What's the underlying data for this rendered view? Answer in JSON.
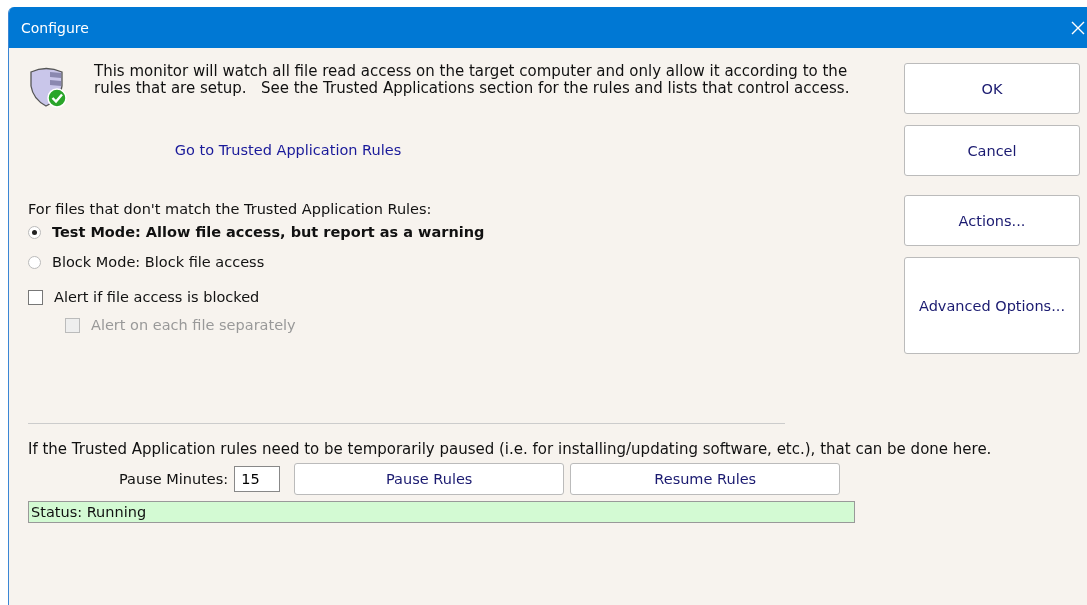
{
  "window": {
    "title": "Configure"
  },
  "intro": "This monitor will watch all file read access on the target computer and only allow it according to the rules that are setup.   See the Trusted Applications section for the rules and lists that control access.",
  "link": "Go to Trusted Application Rules",
  "mode_label": "For files that don't match the Trusted Application Rules:",
  "modes": [
    {
      "label": "Test Mode: Allow file access, but report as a warning",
      "selected": true
    },
    {
      "label": "Block Mode: Block file access",
      "selected": false
    }
  ],
  "options": [
    {
      "label": "Alert if file access is blocked",
      "checked": false,
      "disabled": false,
      "children": [
        {
          "label": "Alert on each file separately",
          "checked": false,
          "disabled": true
        }
      ]
    }
  ],
  "pause_note": "If the Trusted Application rules need to be temporarily paused (i.e. for installing/updating software, etc.), that can be done here.",
  "pause_minutes": {
    "label": "Pause Minutes:",
    "value": "15"
  },
  "pause_buttons": [
    "Pause Rules",
    "Resume Rules"
  ],
  "status": "Status: Running",
  "buttons": [
    "OK",
    "Cancel",
    "Actions...",
    "Advanced Options..."
  ]
}
